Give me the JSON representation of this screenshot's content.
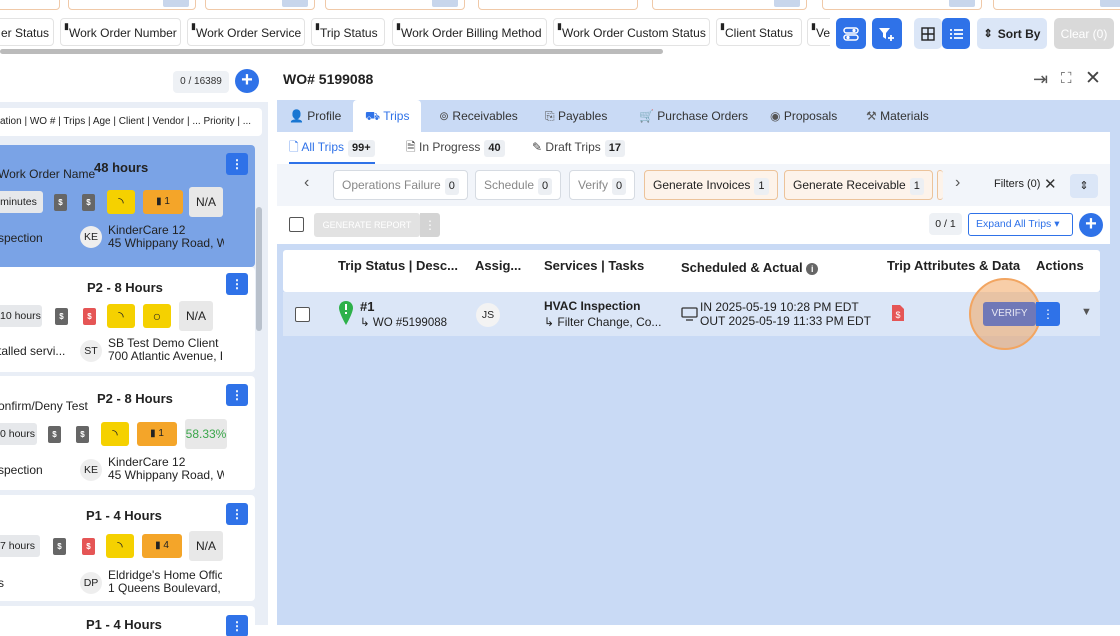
{
  "top_filters": {
    "columns": [
      "er Status",
      "Work Order Number",
      "Work Order Service",
      "Trip Status",
      "Work Order Billing Method",
      "Work Order Custom Status",
      "Client Status",
      "Ve"
    ],
    "sort_label": "Sort By",
    "clear_label": "Clear (0)"
  },
  "left_panel": {
    "count": "0 / 16389",
    "column_header": "ation | WO # | Trips | Age | Client | Vendor | ... Priority | ...",
    "cards": [
      {
        "label": "Work Order Name",
        "priority": "48 hours",
        "time": "minutes",
        "bill": "1",
        "status": "N/A",
        "service": "spection",
        "avatar": "KE",
        "addr1": "KinderCare 12",
        "addr2": "45 Whippany Road, W"
      },
      {
        "label": "",
        "priority": "P2 - 8 Hours",
        "time": "10 hours",
        "bill": "",
        "status": "N/A",
        "service": "talled servi...",
        "avatar": "ST",
        "addr1": "SB Test Demo Client S",
        "addr2": "700 Atlantic Avenue, E"
      },
      {
        "label": "onfirm/Deny Test",
        "priority": "P2 - 8 Hours",
        "time": "0 hours",
        "bill": "1",
        "status": "58.33%",
        "service": "spection",
        "avatar": "KE",
        "addr1": "KinderCare 12",
        "addr2": "45 Whippany Road, W"
      },
      {
        "label": "",
        "priority": "P1 - 4 Hours",
        "time": "7 hours",
        "bill": "4",
        "status": "N/A",
        "service": "s",
        "avatar": "DP",
        "addr1": "Eldridge's Home Offic",
        "addr2": "1 Queens Boulevard, F"
      },
      {
        "label": "",
        "priority": "P1 - 4 Hours"
      }
    ]
  },
  "wo": {
    "title": "WO# 5199088",
    "tabs": [
      "Profile",
      "Trips",
      "Receivables",
      "Payables",
      "Purchase Orders",
      "Proposals",
      "Materials"
    ],
    "subtabs": [
      {
        "label": "All Trips",
        "count": "99+"
      },
      {
        "label": "In Progress",
        "count": "40"
      },
      {
        "label": "Draft Trips",
        "count": "17"
      }
    ],
    "statuses": [
      {
        "label": "Operations Failure",
        "count": "0"
      },
      {
        "label": "Schedule",
        "count": "0"
      },
      {
        "label": "Verify",
        "count": "0"
      },
      {
        "label": "Generate Invoices",
        "count": "1"
      },
      {
        "label": "Generate Receivable",
        "count": "1"
      }
    ],
    "filters_label": "Filters (0)",
    "generate_report": "GENERATE REPORT",
    "selection_count": "0 / 1",
    "expand_label": "Expand All Trips",
    "columns": [
      "Trip Status | Desc...",
      "Assig...",
      "Services | Tasks",
      "Scheduled & Actual",
      "Trip Attributes & Data",
      "Actions"
    ],
    "trip": {
      "number": "#1",
      "wo": "WO #5199088",
      "assignee": "JS",
      "service": "HVAC Inspection",
      "task": "Filter Change, Co...",
      "in": "IN 2025-05-19 10:28 PM EDT",
      "out": "OUT 2025-05-19 11:33 PM EDT",
      "action": "VERIFY"
    }
  },
  "colors": {
    "accent": "#2f72e8",
    "selected_card": "#7aa3e6",
    "panel_bg": "#c9daf5",
    "highlight_ring": "#f2a561"
  }
}
